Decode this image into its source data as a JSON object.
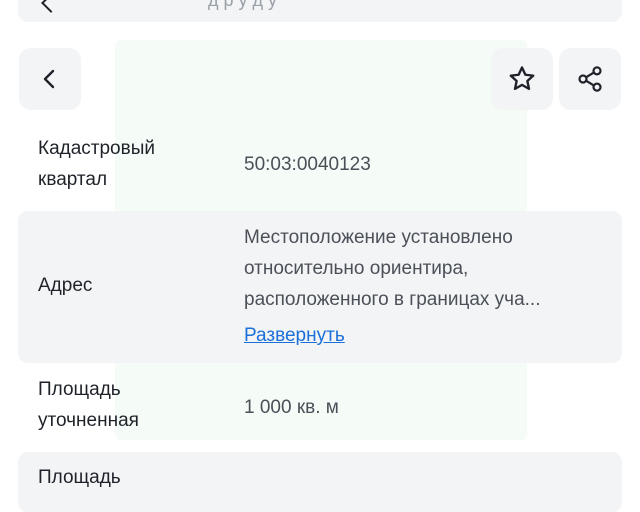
{
  "top_bar": {
    "partial_text": "д   р у   д   у"
  },
  "header": {
    "back_icon": "chevron-left-icon",
    "favorite_icon": "star-icon",
    "share_icon": "share-icon"
  },
  "details": {
    "cadastral": {
      "label_line1": "Кадастровый",
      "label_line2": "квартал",
      "value": "50:03:0040123"
    },
    "address": {
      "label": "Адрес",
      "value_line1": "Местоположение установлено",
      "value_line2": "относительно ориентира,",
      "value_line3": "расположенного в границах уча...",
      "expand_link": "Развернуть"
    },
    "area_refined": {
      "label_line1": "Площадь",
      "label_line2": "уточненная",
      "value": "1 000 кв. м"
    },
    "area_next": {
      "label_line1": "Площадь"
    }
  },
  "colors": {
    "accent_link": "#1b6fd8",
    "row_bg": "#f3f4f6"
  }
}
